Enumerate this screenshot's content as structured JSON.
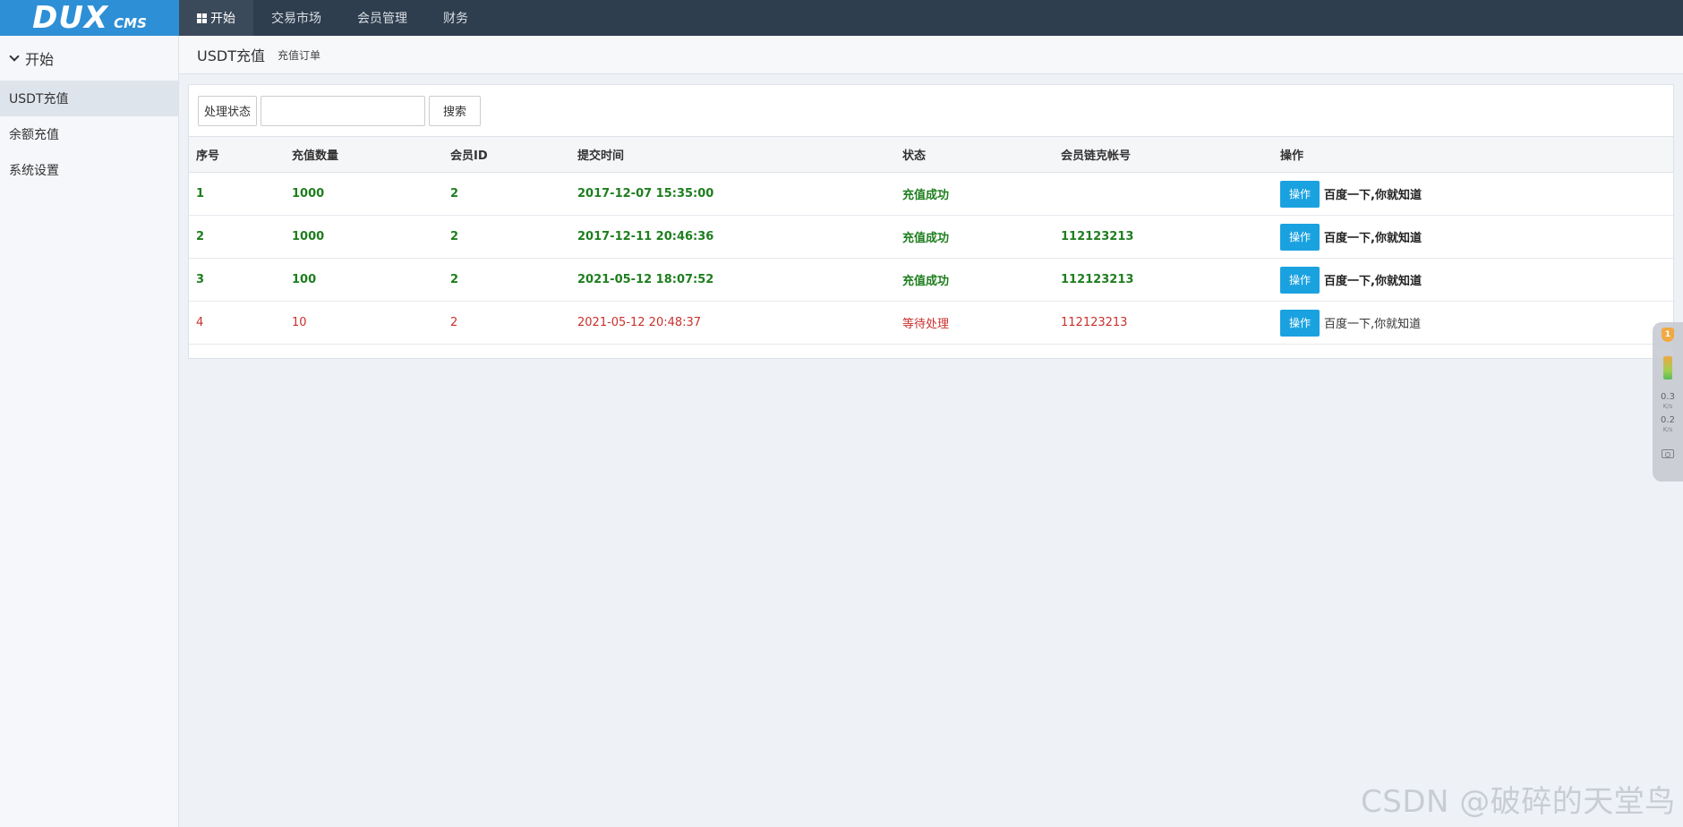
{
  "logo": {
    "main": "DUX",
    "sub": "CMS"
  },
  "topnav": [
    {
      "label": "开始"
    },
    {
      "label": "交易市场"
    },
    {
      "label": "会员管理"
    },
    {
      "label": "财务"
    }
  ],
  "sidebar": {
    "header": "开始",
    "items": [
      {
        "label": "USDT充值"
      },
      {
        "label": "余额充值"
      },
      {
        "label": "系统设置"
      }
    ]
  },
  "breadcrumb": {
    "title": "USDT充值",
    "sub": "充值订单"
  },
  "filter": {
    "status_button": "处理状态",
    "search_value": "",
    "search_placeholder": "",
    "search_button": "搜索"
  },
  "table": {
    "headers": [
      "序号",
      "充值数量",
      "会员ID",
      "提交时间",
      "状态",
      "会员链克帐号",
      "操作"
    ],
    "rows": [
      {
        "id": "1",
        "amount": "1000",
        "member_id": "2",
        "time": "2017-12-07 15:35:00",
        "status": "充值成功",
        "account": "",
        "op_button": "操作",
        "op_link": "百度一下,你就知道"
      },
      {
        "id": "2",
        "amount": "1000",
        "member_id": "2",
        "time": "2017-12-11 20:46:36",
        "status": "充值成功",
        "account": "112123213",
        "op_button": "操作",
        "op_link": "百度一下,你就知道"
      },
      {
        "id": "3",
        "amount": "100",
        "member_id": "2",
        "time": "2021-05-12 18:07:52",
        "status": "充值成功",
        "account": "112123213",
        "op_button": "操作",
        "op_link": "百度一下,你就知道"
      },
      {
        "id": "4",
        "amount": "10",
        "member_id": "2",
        "time": "2021-05-12 20:48:37",
        "status": "等待处理",
        "account": "112123213",
        "op_button": "操作",
        "op_link": "百度一下,你就知道"
      }
    ]
  },
  "widget": {
    "badge": "1",
    "up_speed": "0.3",
    "up_unit": "K/s",
    "down_speed": "0.2",
    "down_unit": "K/s"
  },
  "colors": {
    "topbar": "#2f3e4e",
    "logo_bg": "#2d8fd5",
    "success": "#1e7e1e",
    "pending": "#c9302c",
    "op_button": "#1aa2e0"
  },
  "watermark": "CSDN @破碎的天堂鸟"
}
